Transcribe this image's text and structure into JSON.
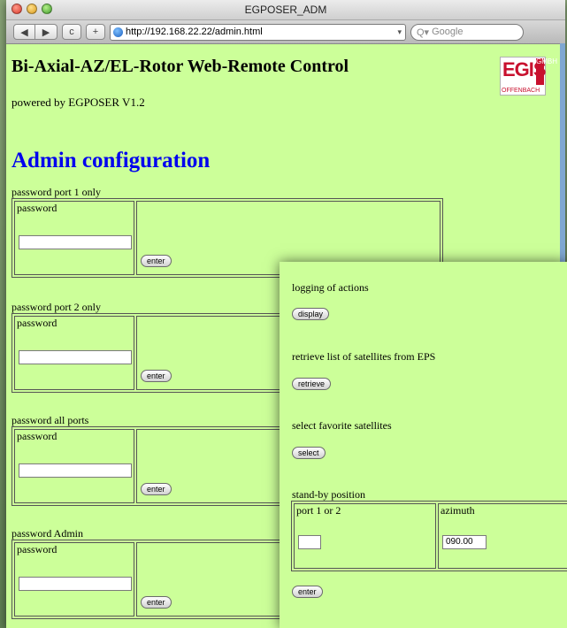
{
  "window": {
    "title": "EGPOSER_ADM"
  },
  "toolbar": {
    "back_icon": "back-arrow-icon",
    "forward_icon": "forward-arrow-icon",
    "reload_label": "c",
    "add_label": "+",
    "url": "http://192.168.22.22/admin.html",
    "search_placeholder": "Google"
  },
  "page": {
    "heading": "Bi-Axial-AZ/EL-Rotor Web-Remote Control",
    "powered_by": "powered by EGPOSER V1.2",
    "admin_heading": "Admin configuration",
    "logo": {
      "main": "EGIS",
      "side": "GMBH",
      "sub": "OFFENBACH",
      "color": "#c8102e"
    },
    "password_sections": [
      {
        "caption": "password port 1 only",
        "label": "password",
        "value": "",
        "button": "enter"
      },
      {
        "caption": "password port 2 only",
        "label": "password",
        "value": "",
        "button": "enter"
      },
      {
        "caption": "password all ports",
        "label": "password",
        "value": "",
        "button": "enter"
      },
      {
        "caption": "password Admin",
        "label": "password",
        "value": "",
        "button": "enter"
      }
    ]
  },
  "panel": {
    "logging_label": "logging of actions",
    "display_button": "display",
    "retrieve_label": "retrieve list of satellites from EPS",
    "retrieve_button": "retrieve",
    "favorite_label": "select favorite satellites",
    "select_button": "select",
    "standby_label": "stand-by position",
    "standby_col1": "port 1 or 2",
    "standby_col2": "azimuth",
    "port_value": "",
    "azimuth_value": "090.00",
    "enter_button": "enter"
  },
  "colors": {
    "page_background": "#ccff99",
    "admin_heading": "#0000ee"
  }
}
